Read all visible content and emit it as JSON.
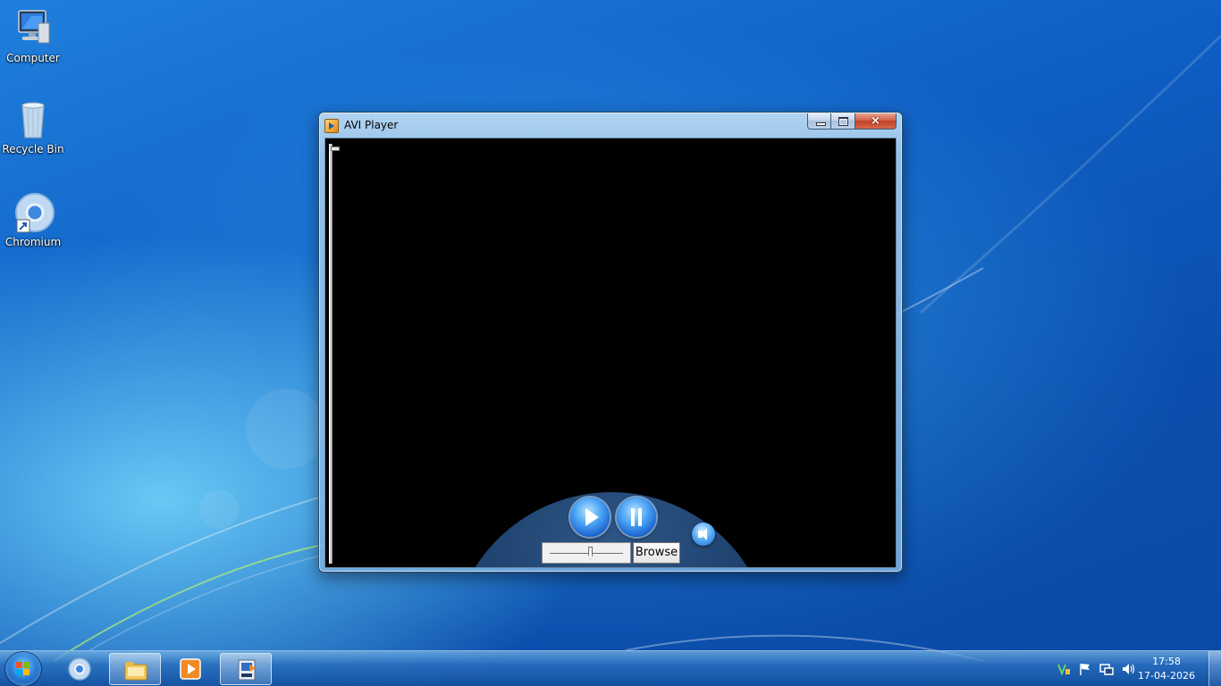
{
  "desktop": {
    "icons": [
      {
        "label": "Computer",
        "icon": "computer-icon"
      },
      {
        "label": "Recycle Bin",
        "icon": "recycle-bin-icon"
      },
      {
        "label": "Chromium",
        "icon": "chromium-icon"
      }
    ]
  },
  "window": {
    "title": "AVI Player",
    "controls": {
      "minimize": "minimize",
      "maximize": "maximize",
      "close": "×"
    },
    "player": {
      "play_icon": "play-icon",
      "pause_icon": "pause-icon",
      "volume_icon": "volume-icon",
      "browse_label": "Browse",
      "volume_level_fraction": 0.55
    }
  },
  "taskbar": {
    "start": "start-orb",
    "pinned": [
      "chromium-icon",
      "file-explorer-icon",
      "media-player-icon",
      "avi-player-icon"
    ],
    "active": "avi-player-icon",
    "tray": {
      "time": "17:58",
      "date": "17-04-2026"
    }
  },
  "colors": {
    "accent": "#1a63cf",
    "close_red": "#c1412a"
  }
}
